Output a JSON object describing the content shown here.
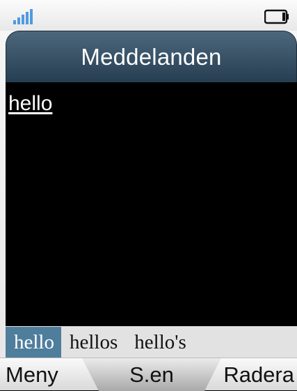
{
  "status": {
    "signal_icon": "signal-bars-icon",
    "battery_icon": "battery-icon"
  },
  "header": {
    "title": "Meddelanden"
  },
  "message": {
    "text": "hello"
  },
  "suggestions": {
    "items": [
      "hello",
      "hellos",
      "hello's"
    ],
    "selected_index": 0
  },
  "softkeys": {
    "left": "Meny",
    "center": "S.en",
    "right": "Radera"
  },
  "colors": {
    "title_bar": "#35506a",
    "selected_suggestion": "#4f7d9c",
    "signal": "#4f9ae0"
  }
}
